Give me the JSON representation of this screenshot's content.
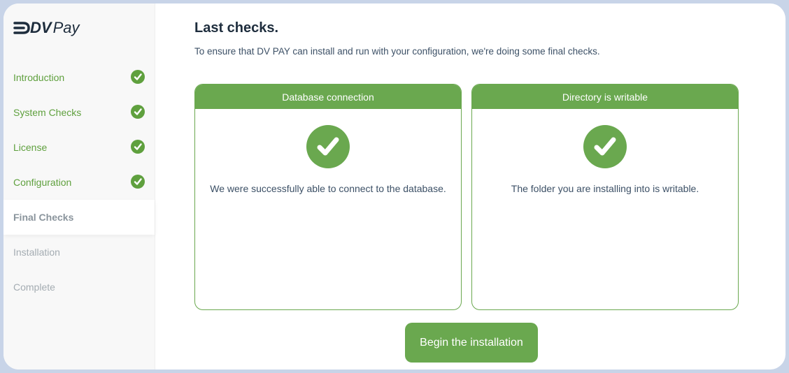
{
  "brand": {
    "logo_dv": "DV",
    "logo_pay": "Pay"
  },
  "sidebar": {
    "items": [
      {
        "label": "Introduction",
        "status": "done"
      },
      {
        "label": "System Checks",
        "status": "done"
      },
      {
        "label": "License",
        "status": "done"
      },
      {
        "label": "Configuration",
        "status": "done"
      },
      {
        "label": "Final Checks",
        "status": "active"
      },
      {
        "label": "Installation",
        "status": "pending"
      },
      {
        "label": "Complete",
        "status": "pending"
      }
    ]
  },
  "main": {
    "title": "Last checks.",
    "subtitle": "To ensure that DV PAY can install and run with your configuration, we're doing some final checks.",
    "cards": [
      {
        "header": "Database connection",
        "icon": "check-circle-icon",
        "message": "We were successfully able to connect to the database."
      },
      {
        "header": "Directory is writable",
        "icon": "check-circle-icon",
        "message": "The folder you are installing into is writable."
      }
    ],
    "begin_button": "Begin the installation"
  },
  "colors": {
    "accent": "#6aa84f",
    "sidebar_done": "#5fa03e",
    "title": "#1e2d3d",
    "body_text": "#3c5066",
    "frame_bg": "#c8d4e8"
  }
}
